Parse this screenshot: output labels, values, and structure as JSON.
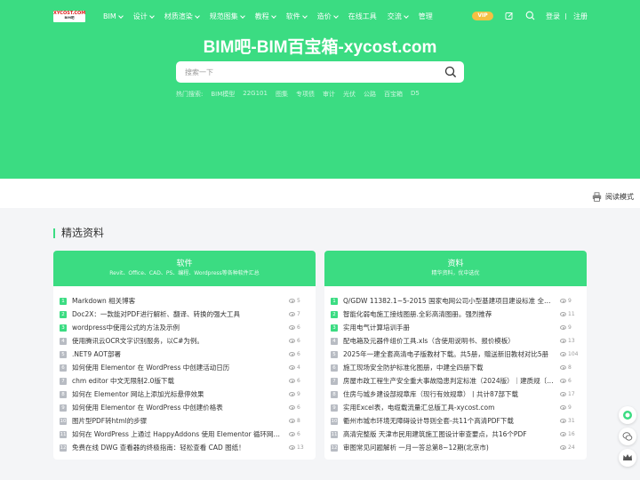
{
  "logo": {
    "text": "XYCOST.COM",
    "sub": "BIM吧"
  },
  "nav": {
    "items": [
      {
        "label": "BIM",
        "dropdown": true
      },
      {
        "label": "设计",
        "dropdown": true
      },
      {
        "label": "材质渲染",
        "dropdown": true
      },
      {
        "label": "规范图集",
        "dropdown": true
      },
      {
        "label": "教程",
        "dropdown": true
      },
      {
        "label": "软件",
        "dropdown": true
      },
      {
        "label": "造价",
        "dropdown": true
      },
      {
        "label": "在线工具",
        "dropdown": false
      },
      {
        "label": "交流",
        "dropdown": true
      },
      {
        "label": "管理",
        "dropdown": false
      }
    ],
    "vip": "VIP",
    "login": "登录",
    "register": "注册"
  },
  "hero": {
    "title": "BIM吧-BIM百宝箱-xycost.com",
    "search_placeholder": "搜索一下",
    "hot_label": "热门搜索:",
    "hot_terms": [
      "BIM模型",
      "22G101",
      "图集",
      "专项债",
      "审计",
      "光伏",
      "公路",
      "百宝箱",
      "D5"
    ]
  },
  "reader_mode": "阅读模式",
  "section_title": "精选资料",
  "cards": [
    {
      "title": "软件",
      "subtitle": "Revit、Office、CAD、PS、编程、Wordpress等各种软件汇总",
      "items": [
        {
          "n": "1",
          "title": "Markdown 相关博客",
          "views": "5"
        },
        {
          "n": "2",
          "title": "Doc2X：一款能对PDF进行解析、翻译、转换的强大工具",
          "views": "7"
        },
        {
          "n": "3",
          "title": "wordpress中使用公式的方法及示例",
          "views": "6"
        },
        {
          "n": "4",
          "title": "使用腾讯云OCR文字识别服务，以C#为例。",
          "views": "6"
        },
        {
          "n": "5",
          "title": ".NET9 AOT部署",
          "views": "6"
        },
        {
          "n": "6",
          "title": "如何使用 Elementor 在 WordPress 中创建活动日历",
          "views": "4"
        },
        {
          "n": "7",
          "title": "chm editor 中文无限制2.0版下载",
          "views": "6"
        },
        {
          "n": "8",
          "title": "如何在 Elementor 网站上添加光标悬停效果",
          "views": "9"
        },
        {
          "n": "9",
          "title": "如何使用 Elementor 在 WordPress 中创建价格表",
          "views": "6"
        },
        {
          "n": "10",
          "title": "图片型PDF转html的步骤",
          "views": "8"
        },
        {
          "n": "11",
          "title": "如何在 WordPress 上通过 HappyAddons 使用 Elementor 循环网格小部件",
          "views": "6"
        },
        {
          "n": "12",
          "title": "免费在线 DWG 查看器的终极指南：轻松查看 CAD 图纸！",
          "views": "13"
        }
      ]
    },
    {
      "title": "资料",
      "subtitle": "精华资料，优中选优",
      "items": [
        {
          "n": "1",
          "title": "Q/GDW 11382.1~5-2015 国家电网公司小型基建项目建设标准 全5册（供...",
          "views": "9"
        },
        {
          "n": "2",
          "title": "智能化弱电施工接线图册.全彩高清图册。强烈推荐",
          "views": "11"
        },
        {
          "n": "3",
          "title": "实用电气计算培训手册",
          "views": "9"
        },
        {
          "n": "4",
          "title": "配电箱及元器件组价工具.xls（含使用说明书、报价模板）",
          "views": "13"
        },
        {
          "n": "5",
          "title": "2025年一建全套高清电子版教材下载。共5册，赠送新旧教材对比5册",
          "views": "104"
        },
        {
          "n": "6",
          "title": "施工现场安全防护标准化图册，中建全四册下载",
          "views": "8"
        },
        {
          "n": "7",
          "title": "房屋市政工程生产安全重大事故隐患判定标准（2024版）｜建质规〔2024〕...",
          "views": "6"
        },
        {
          "n": "8",
          "title": "住房与城乡建设部规章库（现行有效规章）丨共计87部下载",
          "views": "17"
        },
        {
          "n": "9",
          "title": "实用Excel表，电缆载流量汇总版工具-xycost.com",
          "views": "9"
        },
        {
          "n": "10",
          "title": "衢州市城市环境无障碍设计导则全套-共11个高清PDF下载",
          "views": "31"
        },
        {
          "n": "11",
          "title": "高清完整版 天津市民用建筑施工图设计审查要点，共16个PDF",
          "views": "16"
        },
        {
          "n": "12",
          "title": "审图常见问题解析 一月一答总第8~12期(北京市)",
          "views": "24"
        }
      ]
    }
  ],
  "colors": {
    "brand": "#3bdc82",
    "vip": "#f5c043",
    "badge_gray": "#b8bcc3"
  },
  "icons": [
    "edit-icon",
    "search-icon",
    "printer-icon",
    "eye-icon",
    "service-icon",
    "chat-icon",
    "crown-icon"
  ]
}
